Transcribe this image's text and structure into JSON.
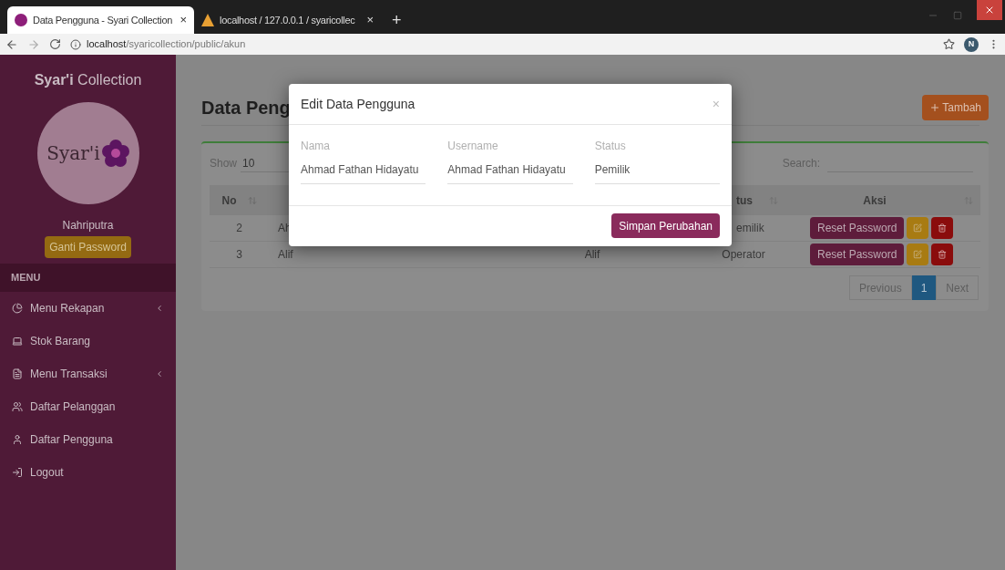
{
  "browser": {
    "tabs": [
      {
        "title": "Data Pengguna - Syari Collection",
        "close": "×",
        "selected": true
      },
      {
        "title": "localhost / 127.0.0.1 / syaricollec",
        "close": "×",
        "selected": false
      }
    ],
    "new_tab": "+",
    "url_host": "localhost",
    "url_path": "/syaricollection/public/akun",
    "profile": "N"
  },
  "sidebar": {
    "title": "**Syar'i** Collection",
    "logo_text": "Syar'i",
    "user": "Nahriputra",
    "change_password": "Ganti Password",
    "menu_header": "MENU",
    "items": [
      {
        "label": "Menu Rekapan",
        "kind": "pie",
        "expandable": true
      },
      {
        "label": "Stok Barang",
        "kind": "laptop",
        "expandable": false
      },
      {
        "label": "Menu Transaksi",
        "kind": "file",
        "expandable": true
      },
      {
        "label": "Daftar Pelanggan",
        "kind": "users",
        "expandable": false
      },
      {
        "label": "Daftar Pengguna",
        "kind": "user",
        "expandable": false
      },
      {
        "label": "Logout",
        "kind": "exit",
        "expandable": false
      }
    ]
  },
  "page": {
    "title": "Data Peng",
    "add_button": "Tambah"
  },
  "table": {
    "show_label": "Show",
    "page_size": "10",
    "search_label": "Search:",
    "columns": [
      "No",
      "tus",
      "Aksi"
    ],
    "rows": [
      {
        "no": "2",
        "nama": "Ah",
        "status": "emilik",
        "reset_button": "Reset Password"
      },
      {
        "no": "3",
        "nama": "Alif",
        "username": "Alif",
        "status": "Operator",
        "reset_button": "Reset Password"
      }
    ],
    "pagination": [
      {
        "label": "Previous",
        "selected": false
      },
      {
        "label": "1",
        "selected": true
      },
      {
        "label": "Next",
        "selected": false
      }
    ]
  },
  "modal": {
    "title": "Edit Data Pengguna",
    "close": "×",
    "fields": [
      {
        "label": "Nama",
        "value": "Ahmad Fathan Hidayatu"
      },
      {
        "label": "Username",
        "value": "Ahmad Fathan Hidayatu"
      },
      {
        "label": "Status",
        "value": "Pemilik"
      }
    ],
    "save_button": "Simpan Perubahan"
  }
}
